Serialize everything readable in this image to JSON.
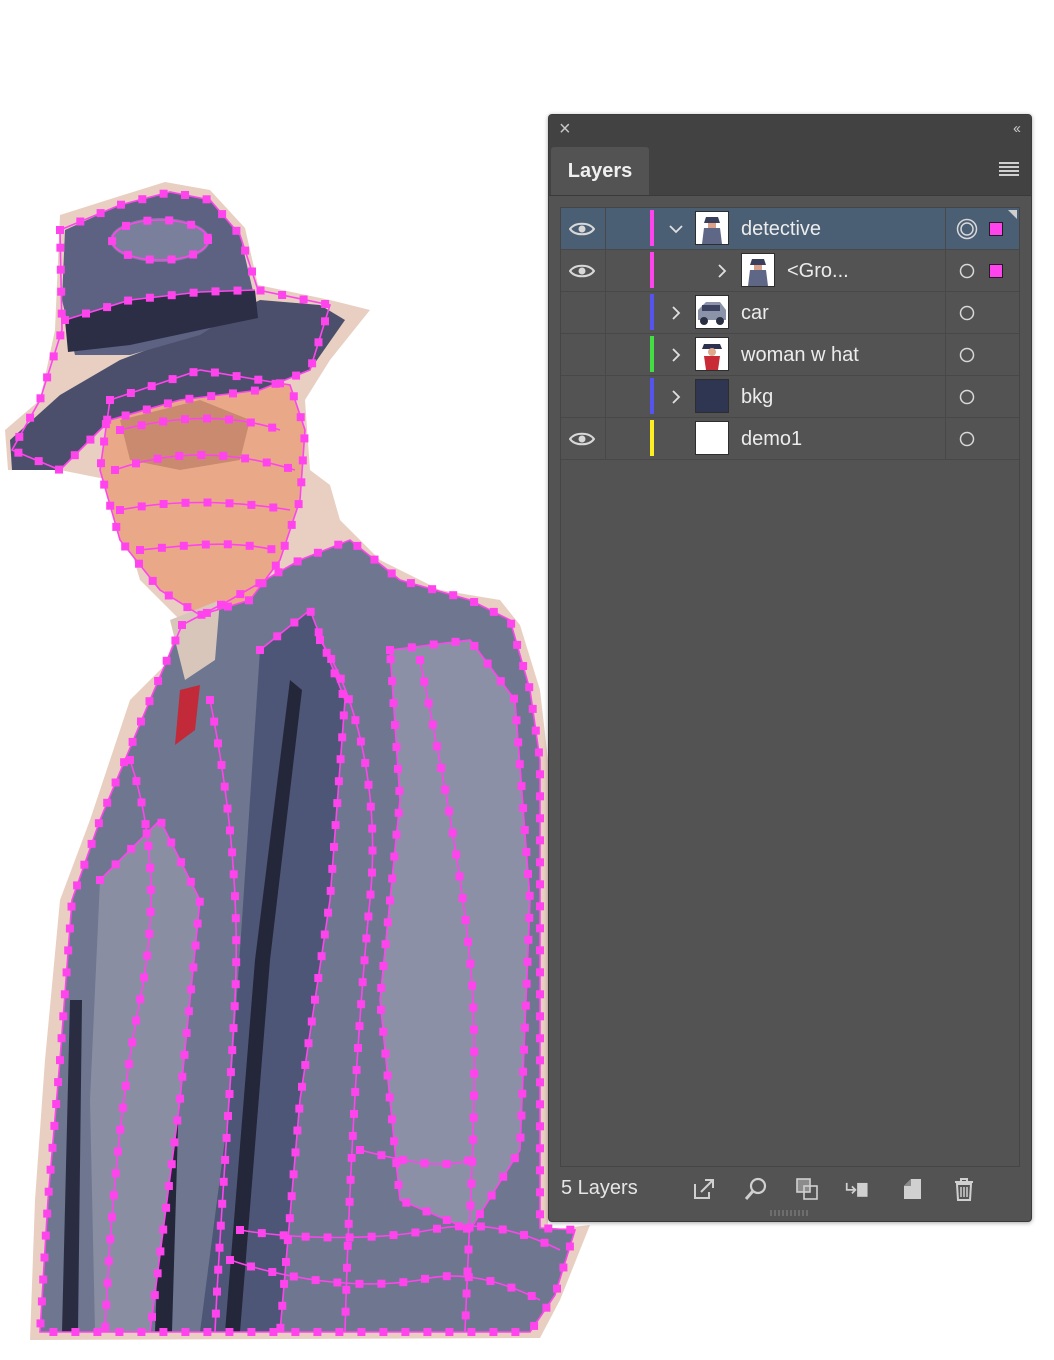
{
  "panel": {
    "tab_label": "Layers",
    "footer_count": "5 Layers",
    "layers": [
      {
        "name": "detective",
        "visible": true,
        "expanded": true,
        "indent": 0,
        "color": "#ff44ee",
        "selected": true,
        "thumb": "detective-thumb",
        "target_active": true,
        "has_selection": true
      },
      {
        "name": "<Gro...",
        "visible": true,
        "expanded": false,
        "indent": 1,
        "color": "#ff44ee",
        "selected": false,
        "thumb": "detective-thumb",
        "target_active": false,
        "has_selection": true
      },
      {
        "name": "car",
        "visible": false,
        "expanded": false,
        "indent": 0,
        "color": "#5555ee",
        "selected": false,
        "thumb": "car-thumb",
        "target_active": false,
        "has_selection": false
      },
      {
        "name": "woman w hat",
        "visible": false,
        "expanded": false,
        "indent": 0,
        "color": "#44dd44",
        "selected": false,
        "thumb": "woman-thumb",
        "target_active": false,
        "has_selection": false
      },
      {
        "name": "bkg",
        "visible": false,
        "expanded": false,
        "indent": 0,
        "color": "#5555ee",
        "selected": false,
        "thumb": "bkg-thumb",
        "target_active": false,
        "has_selection": false
      },
      {
        "name": "demo1",
        "visible": true,
        "expanded": null,
        "indent": 0,
        "color": "#ffee22",
        "selected": false,
        "thumb": "blank-thumb",
        "target_active": false,
        "has_selection": false
      }
    ],
    "footer_buttons": [
      "export-icon",
      "locate-object-icon",
      "clipping-mask-icon",
      "move-to-layer-icon",
      "new-layer-icon",
      "delete-icon"
    ]
  },
  "colors": {
    "selection_path": "#ff44ee",
    "panel_bg": "#535353",
    "selected_row": "#4a5e74"
  }
}
